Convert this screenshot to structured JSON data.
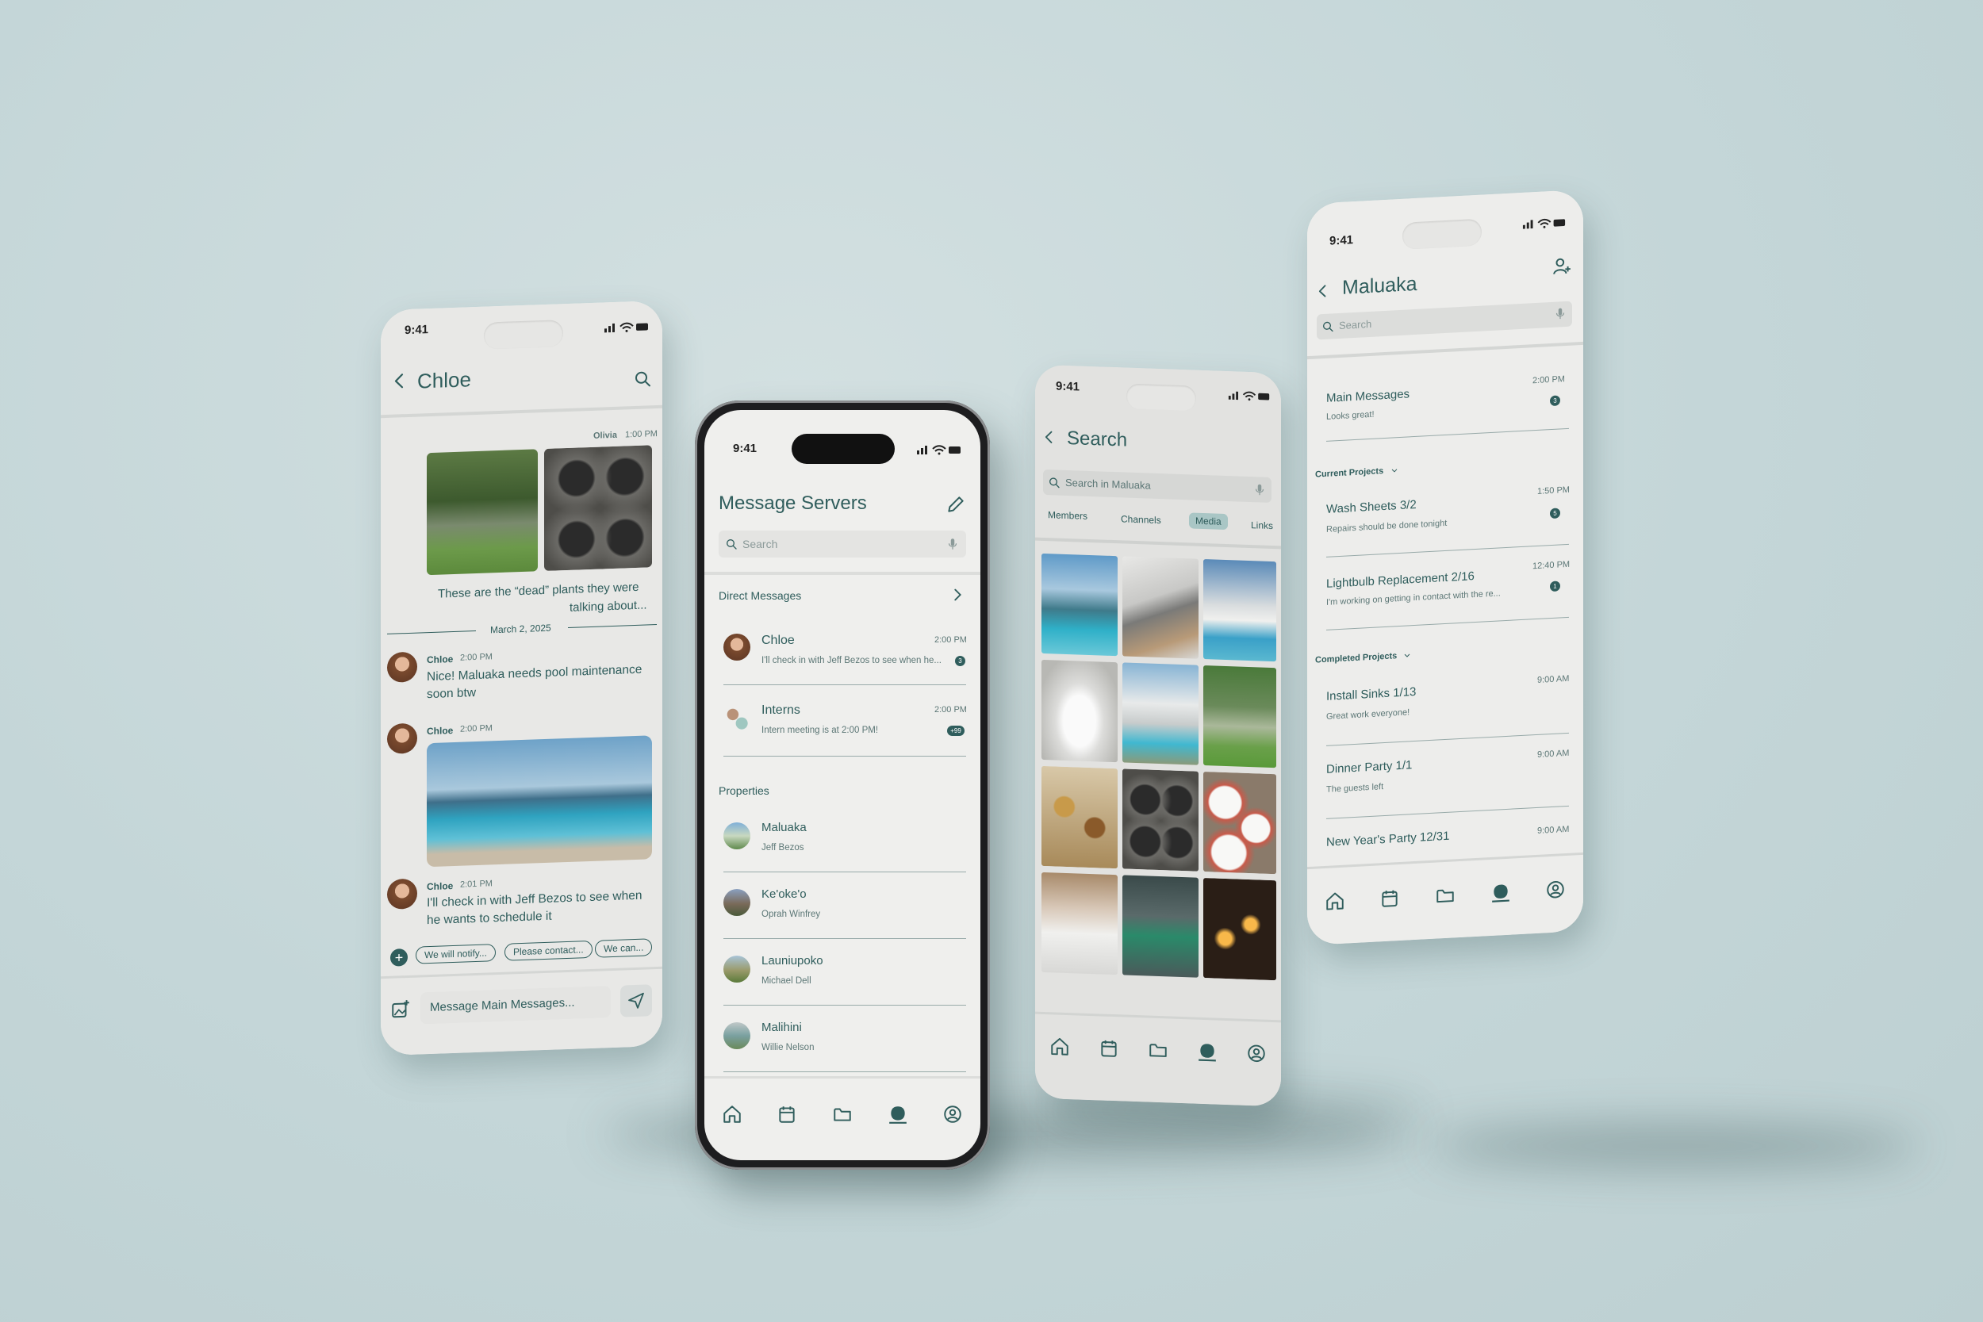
{
  "status_time": "9:41",
  "chloe": {
    "title": "Chloe",
    "sender_top": "Olivia",
    "time_top": "1:00 PM",
    "caption_line1": "These are the “dead” plants they were",
    "caption_line2": "talking about...",
    "date_divider": "March 2, 2025",
    "messages": [
      {
        "sender": "Chloe",
        "time": "2:00 PM",
        "line1": "Nice! Maluaka needs pool maintenance",
        "line2": "soon btw"
      },
      {
        "sender": "Chloe",
        "time": "2:00 PM"
      },
      {
        "sender": "Chloe",
        "time": "2:01 PM",
        "line1": "I'll check in with Jeff Bezos to see when",
        "line2": "he wants to schedule it"
      }
    ],
    "chips": [
      "We will notify...",
      "Please contact...",
      "We can..."
    ],
    "input_placeholder": "Message Main Messages..."
  },
  "servers": {
    "title": "Message Servers",
    "search_placeholder": "Search",
    "direct_label": "Direct Messages",
    "direct": [
      {
        "name": "Chloe",
        "preview": "I'll check in with Jeff Bezos to see when he...",
        "time": "2:00 PM",
        "badge": "3"
      },
      {
        "name": "Interns",
        "preview": "Intern meeting is at 2:00 PM!",
        "time": "2:00 PM",
        "badge": "+99"
      }
    ],
    "properties_label": "Properties",
    "properties": [
      {
        "name": "Maluaka",
        "owner": "Jeff Bezos"
      },
      {
        "name": "Ke'oke'o",
        "owner": "Oprah Winfrey"
      },
      {
        "name": "Launiupoko",
        "owner": "Michael Dell"
      },
      {
        "name": "Malihini",
        "owner": "Willie Nelson"
      }
    ]
  },
  "search": {
    "title": "Search",
    "placeholder": "Search in Maluaka",
    "tabs": [
      "Members",
      "Channels",
      "Media",
      "Links"
    ],
    "active_tab": "Media"
  },
  "maluaka": {
    "title": "Maluaka",
    "search_placeholder": "Search",
    "main": {
      "name": "Main Messages",
      "preview": "Looks great!",
      "time": "2:00 PM",
      "badge": "3"
    },
    "current_label": "Current Projects",
    "current": [
      {
        "name": "Wash Sheets 3/2",
        "preview": "Repairs should be done tonight",
        "time": "1:50 PM",
        "badge": "5"
      },
      {
        "name": "Lightbulb Replacement 2/16",
        "preview": "I'm working on getting in contact with the re...",
        "time": "12:40 PM",
        "badge": "1"
      }
    ],
    "completed_label": "Completed Projects",
    "completed": [
      {
        "name": "Install Sinks 1/13",
        "preview": "Great work everyone!",
        "time": "9:00 AM"
      },
      {
        "name": "Dinner Party 1/1",
        "preview": "The guests left",
        "time": "9:00 AM"
      },
      {
        "name": "New Year's Party 12/31",
        "time": "9:00 AM"
      }
    ]
  },
  "nav_icons": [
    "home-icon",
    "calendar-icon",
    "folder-icon",
    "chat-icon",
    "profile-icon"
  ],
  "colors": {
    "accent": "#2f5d5c",
    "background": "#c4d6d8",
    "screen": "#efefed"
  }
}
